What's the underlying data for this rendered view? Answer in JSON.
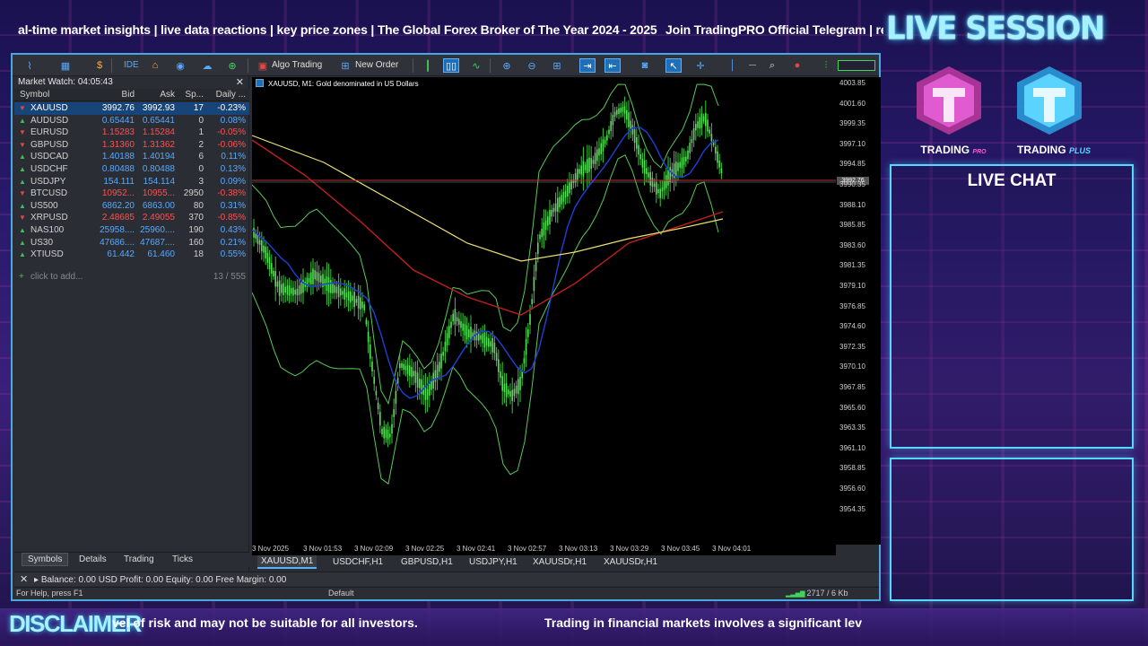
{
  "overlay": {
    "ticker_top_1": "al-time market insights | live data reactions | key price zones | The Global Forex Broker of The Year 2024 - 2025",
    "ticker_top_2": "Join TradingPRO Official Telegram | rea",
    "live_session": "LIVE SESSION",
    "logo_pro": "TRADING",
    "logo_pro_sub": "PRO",
    "logo_plus": "TRADING",
    "logo_plus_sub": "PLUS",
    "live_chat": "LIVE CHAT",
    "disclaimer": "DISCLAIMER",
    "ticker_bottom_1": "vel of risk and may not be suitable for all investors.",
    "ticker_bottom_2": "Trading in financial markets involves a significant lev"
  },
  "toolbar": {
    "algo_trading": "Algo Trading",
    "new_order": "New Order",
    "ide": "IDE"
  },
  "market_watch": {
    "title": "Market Watch: 04:05:43",
    "headers": {
      "symbol": "Symbol",
      "bid": "Bid",
      "ask": "Ask",
      "spread": "Sp...",
      "daily": "Daily ..."
    },
    "rows": [
      {
        "symbol": "XAUUSD",
        "bid": "3992.76",
        "ask": "3992.93",
        "spread": "17",
        "daily": "-0.23%"
      },
      {
        "symbol": "AUDUSD",
        "bid": "0.65441",
        "ask": "0.65441",
        "spread": "0",
        "daily": "0.08%"
      },
      {
        "symbol": "EURUSD",
        "bid": "1.15283",
        "ask": "1.15284",
        "spread": "1",
        "daily": "-0.05%"
      },
      {
        "symbol": "GBPUSD",
        "bid": "1.31360",
        "ask": "1.31362",
        "spread": "2",
        "daily": "-0.06%"
      },
      {
        "symbol": "USDCAD",
        "bid": "1.40188",
        "ask": "1.40194",
        "spread": "6",
        "daily": "0.11%"
      },
      {
        "symbol": "USDCHF",
        "bid": "0.80488",
        "ask": "0.80488",
        "spread": "0",
        "daily": "0.13%"
      },
      {
        "symbol": "USDJPY",
        "bid": "154.111",
        "ask": "154.114",
        "spread": "3",
        "daily": "0.09%"
      },
      {
        "symbol": "BTCUSD",
        "bid": "10952...",
        "ask": "10955...",
        "spread": "2950",
        "daily": "-0.38%"
      },
      {
        "symbol": "US500",
        "bid": "6862.20",
        "ask": "6863.00",
        "spread": "80",
        "daily": "0.31%"
      },
      {
        "symbol": "XRPUSD",
        "bid": "2.48685",
        "ask": "2.49055",
        "spread": "370",
        "daily": "-0.85%"
      },
      {
        "symbol": "NAS100",
        "bid": "25958....",
        "ask": "25960....",
        "spread": "190",
        "daily": "0.43%"
      },
      {
        "symbol": "US30",
        "bid": "47686....",
        "ask": "47687....",
        "spread": "160",
        "daily": "0.21%"
      },
      {
        "symbol": "XTIUSD",
        "bid": "61.442",
        "ask": "61.460",
        "spread": "18",
        "daily": "0.55%"
      }
    ],
    "add_label": "click to add...",
    "count": "13 / 555",
    "tabs": [
      "Symbols",
      "Details",
      "Trading",
      "Ticks"
    ]
  },
  "chart": {
    "title": "XAUUSD, M1:  Gold denominated in US Dollars",
    "price_ticks": [
      "4003.85",
      "4001.60",
      "3999.35",
      "3997.10",
      "3994.85",
      "3992.76",
      "3990.35",
      "3988.10",
      "3985.85",
      "3983.60",
      "3981.35",
      "3979.10",
      "3976.85",
      "3974.60",
      "3972.35",
      "3970.10",
      "3967.85",
      "3965.60",
      "3963.35",
      "3961.10",
      "3958.85",
      "3956.60",
      "3954.35"
    ],
    "current_price": "3992.76",
    "time_ticks": [
      "3 Nov 2025",
      "3 Nov 01:53",
      "3 Nov 02:09",
      "3 Nov 02:25",
      "3 Nov 02:41",
      "3 Nov 02:57",
      "3 Nov 03:13",
      "3 Nov 03:29",
      "3 Nov 03:45",
      "3 Nov 04:01"
    ],
    "tabs": [
      "XAUUSD,M1",
      "USDCHF,H1",
      "GBPUSD,H1",
      "USDJPY,H1",
      "XAUUSDr,H1",
      "XAUUSDr,H1"
    ]
  },
  "status": {
    "balance": "Balance: 0.00 USD  Profit: 0.00  Equity: 0.00  Free Margin: 0.00",
    "help": "For Help, press F1",
    "profile": "Default",
    "connection": "2717 / 6 Kb"
  }
}
